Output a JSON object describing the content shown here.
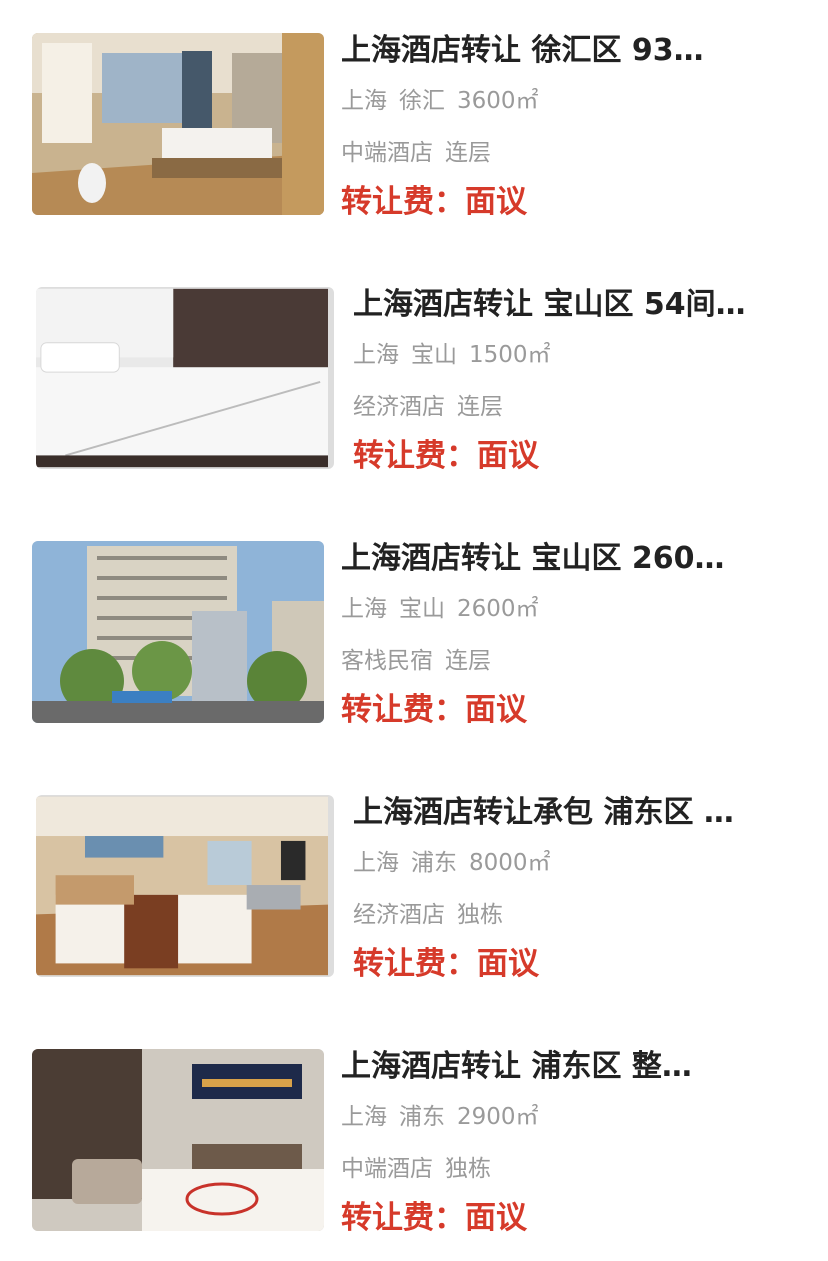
{
  "listings": [
    {
      "title": "上海酒店转让 徐汇区 93…",
      "city": "上海",
      "district": "徐汇",
      "area": "3600㎡",
      "hotel_type": "中端酒店",
      "structure": "连层",
      "fee_label": "转让费：",
      "fee_value": "面议",
      "image_icon": "hotel-room-photo"
    },
    {
      "title": "上海酒店转让 宝山区 54间…",
      "city": "上海",
      "district": "宝山",
      "area": "1500㎡",
      "hotel_type": "经济酒店",
      "structure": "连层",
      "fee_label": "转让费：",
      "fee_value": "面议",
      "image_icon": "hotel-bed-photo"
    },
    {
      "title": "上海酒店转让 宝山区 260…",
      "city": "上海",
      "district": "宝山",
      "area": "2600㎡",
      "hotel_type": "客栈民宿",
      "structure": "连层",
      "fee_label": "转让费：",
      "fee_value": "面议",
      "image_icon": "hotel-building-photo"
    },
    {
      "title": "上海酒店转让承包 浦东区 …",
      "city": "上海",
      "district": "浦东",
      "area": "8000㎡",
      "hotel_type": "经济酒店",
      "structure": "独栋",
      "fee_label": "转让费：",
      "fee_value": "面议",
      "image_icon": "hotel-twin-room-photo"
    },
    {
      "title": "上海酒店转让 浦东区 整…",
      "city": "上海",
      "district": "浦东",
      "area": "2900㎡",
      "hotel_type": "中端酒店",
      "structure": "独栋",
      "fee_label": "转让费：",
      "fee_value": "面议",
      "image_icon": "hotel-suite-photo"
    }
  ],
  "colors": {
    "title": "#222222",
    "meta": "#9a9a9a",
    "fee": "#d63a2a",
    "background": "#ffffff"
  }
}
